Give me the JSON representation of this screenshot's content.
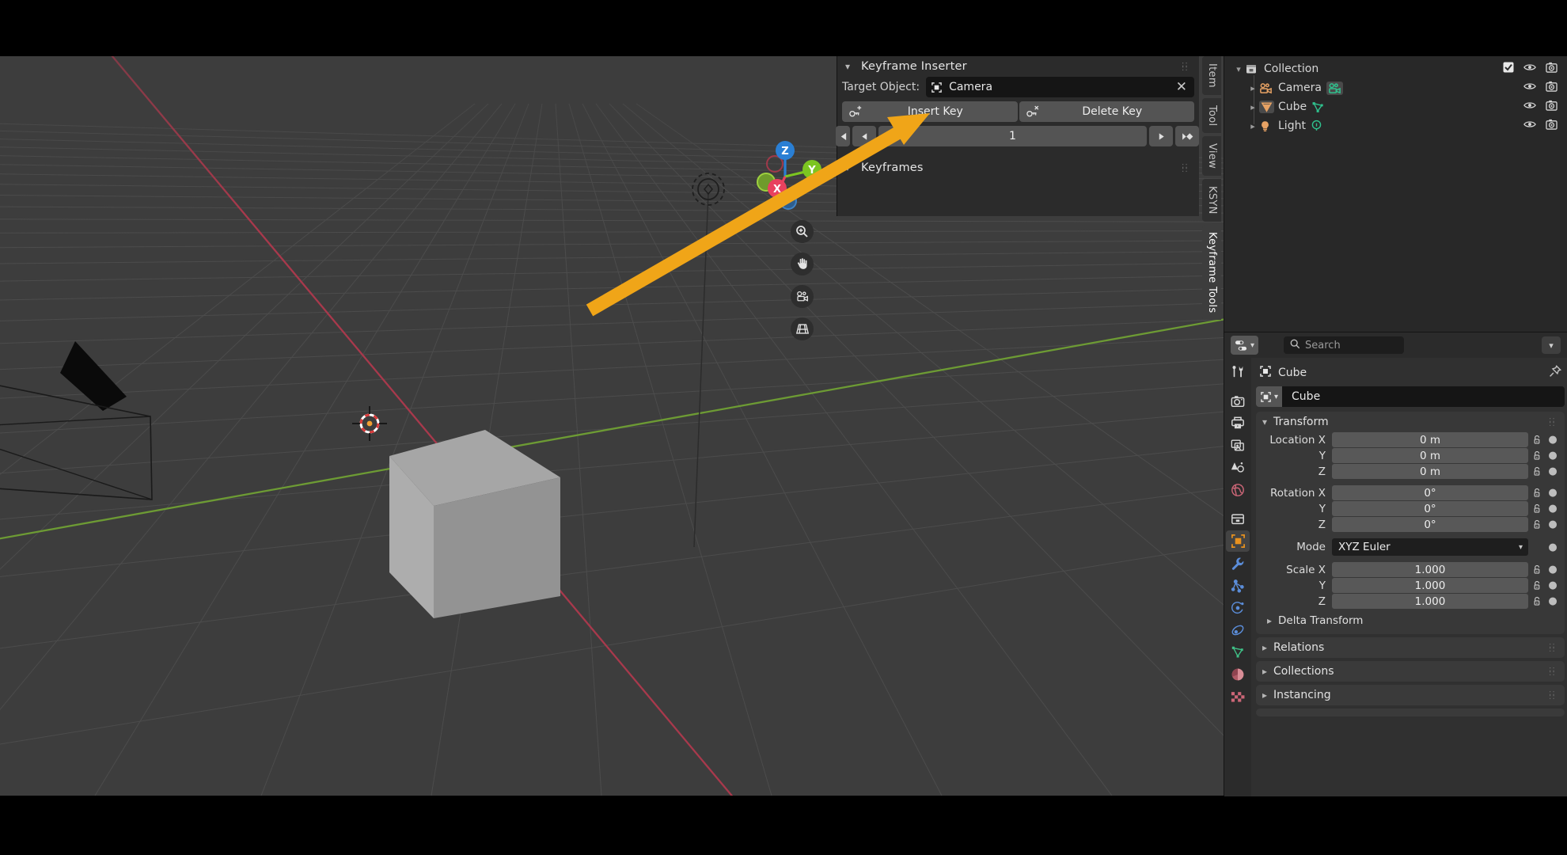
{
  "app": {
    "name": "Blender",
    "theme_bg": "#1d1d1d",
    "accent": "#4772b3"
  },
  "annotation": {
    "arrow_color": "#f0a518",
    "arrow_name": "pointer-arrow-to-target-object"
  },
  "viewport": {
    "name": "3D Viewport",
    "background": "#3d3d3d",
    "grid_color": "#4b4b4b",
    "axis_x_color": "#a3384a",
    "axis_y_color": "#6a9a32",
    "objects": [
      {
        "name": "Camera",
        "type": "camera",
        "display": "wireframe"
      },
      {
        "name": "Cube",
        "type": "mesh",
        "display": "solid",
        "color": "#9b9b9b"
      },
      {
        "name": "Light",
        "type": "light",
        "display": "gizmo"
      }
    ],
    "cursor": {
      "name": "3d-cursor"
    },
    "gizmo": {
      "name": "navigation-gizmo",
      "axes": [
        {
          "label": "Z",
          "color": "#2a7fd4"
        },
        {
          "label": "Y",
          "color": "#7cc521"
        },
        {
          "label": "X",
          "color": "#e8415e"
        }
      ]
    },
    "nav_buttons": [
      {
        "name": "zoom-icon",
        "glyph": "zoom"
      },
      {
        "name": "hand-pan-icon",
        "glyph": "hand"
      },
      {
        "name": "camera-view-icon",
        "glyph": "camera"
      },
      {
        "name": "toggle-ortho-icon",
        "glyph": "grid"
      }
    ],
    "tabs": [
      {
        "label": "Item",
        "active": false
      },
      {
        "label": "Tool",
        "active": false
      },
      {
        "label": "View",
        "active": false
      },
      {
        "label": "KSYN",
        "active": false
      },
      {
        "label": "Keyframe Tools",
        "active": true
      }
    ]
  },
  "keyframe_inserter": {
    "title": "Keyframe Inserter",
    "target_label": "Target Object:",
    "target_value": "Camera",
    "target_icon": "object-icon",
    "clear_icon": "close-icon",
    "insert_key": "Insert Key",
    "delete_key": "Delete Key",
    "insert_icon": "key-add-icon",
    "delete_icon": "key-remove-icon",
    "frame_value": "1",
    "nav": {
      "jump_start": "jump-to-start-icon",
      "prev": "previous-frame-icon",
      "play": "play-icon",
      "jump_end": "jump-to-keyframe-icon"
    }
  },
  "keyframes_panel": {
    "title": "Keyframes"
  },
  "outliner": {
    "name": "Outliner",
    "rows": [
      {
        "label": "Collection",
        "icon": "collection-icon",
        "indent": 0,
        "disclosure": "open",
        "checkbox": true,
        "eye": true,
        "camera": true,
        "data_icon": null,
        "icon_color": "#d0d0d0"
      },
      {
        "label": "Camera",
        "icon": "camera-object-icon",
        "indent": 1,
        "disclosure": "closed",
        "checkbox": false,
        "eye": true,
        "camera": true,
        "data_icon": "camera-data-icon",
        "icon_color": "#e7a264",
        "selected": true
      },
      {
        "label": "Cube",
        "icon": "mesh-object-icon",
        "indent": 1,
        "disclosure": "closed",
        "checkbox": false,
        "eye": true,
        "camera": true,
        "data_icon": "mesh-data-icon",
        "icon_color": "#e7a264",
        "selected": true
      },
      {
        "label": "Light",
        "icon": "light-object-icon",
        "indent": 1,
        "disclosure": "closed",
        "checkbox": false,
        "eye": true,
        "camera": true,
        "data_icon": "light-data-icon",
        "icon_color": "#e7a264",
        "selected": false
      }
    ]
  },
  "properties": {
    "name": "Properties",
    "search_placeholder": "Search",
    "editor_type_icon": "editor-type-icon",
    "breadcrumb_icon": "object-icon",
    "breadcrumb": "Cube",
    "pin_icon": "pin-icon",
    "id_name": "Cube",
    "tabs": [
      {
        "name": "tool-tab",
        "icon": "tool-icon",
        "color": "#d8d8d8",
        "active": false
      },
      {
        "name": "render-tab",
        "icon": "render-camera-icon",
        "color": "#d8d8d8",
        "active": false
      },
      {
        "name": "output-tab",
        "icon": "printer-icon",
        "color": "#d8d8d8",
        "active": false
      },
      {
        "name": "view-layer-tab",
        "icon": "images-icon",
        "color": "#d8d8d8",
        "active": false
      },
      {
        "name": "scene-tab",
        "icon": "scene-cone-icon",
        "color": "#d8d8d8",
        "active": false
      },
      {
        "name": "world-tab",
        "icon": "world-globe-icon",
        "color": "#cc6677",
        "active": false
      },
      {
        "name": "collection-tab",
        "icon": "collection-box-icon",
        "color": "#d8d8d8",
        "active": false
      },
      {
        "name": "object-tab",
        "icon": "object-square-icon",
        "color": "#e8911e",
        "active": true
      },
      {
        "name": "modifiers-tab",
        "icon": "wrench-icon",
        "color": "#5b8dd9",
        "active": false
      },
      {
        "name": "particles-tab",
        "icon": "particles-icon",
        "color": "#5b8dd9",
        "active": false
      },
      {
        "name": "physics-tab",
        "icon": "physics-orbit-icon",
        "color": "#5b8dd9",
        "active": false
      },
      {
        "name": "constraints-tab",
        "icon": "constraint-icon",
        "color": "#5b8dd9",
        "active": false
      },
      {
        "name": "data-tab",
        "icon": "mesh-data-icon",
        "color": "#3fbf86",
        "active": false
      },
      {
        "name": "material-tab",
        "icon": "material-sphere-icon",
        "color": "#cc6677",
        "active": false
      },
      {
        "name": "texture-tab",
        "icon": "texture-checker-icon",
        "color": "#cc6677",
        "active": false
      }
    ],
    "transform": {
      "title": "Transform",
      "rows": [
        {
          "label": "Location X",
          "value": "0 m",
          "lock": true,
          "anim": true
        },
        {
          "label": "Y",
          "value": "0 m",
          "lock": true,
          "anim": true
        },
        {
          "label": "Z",
          "value": "0 m",
          "lock": true,
          "anim": true
        },
        {
          "label": "Rotation X",
          "value": "0°",
          "lock": true,
          "anim": true,
          "spacer": true
        },
        {
          "label": "Y",
          "value": "0°",
          "lock": true,
          "anim": true
        },
        {
          "label": "Z",
          "value": "0°",
          "lock": true,
          "anim": true
        },
        {
          "label": "Mode",
          "value": "XYZ Euler",
          "lock": false,
          "anim": true,
          "dropdown": true,
          "spacer": true
        },
        {
          "label": "Scale X",
          "value": "1.000",
          "lock": true,
          "anim": true
        },
        {
          "label": "Y",
          "value": "1.000",
          "lock": true,
          "anim": true
        },
        {
          "label": "Z",
          "value": "1.000",
          "lock": true,
          "anim": true
        }
      ],
      "delta_transform": "Delta Transform"
    },
    "closed_panels": [
      {
        "label": "Relations"
      },
      {
        "label": "Collections"
      },
      {
        "label": "Instancing"
      }
    ]
  }
}
